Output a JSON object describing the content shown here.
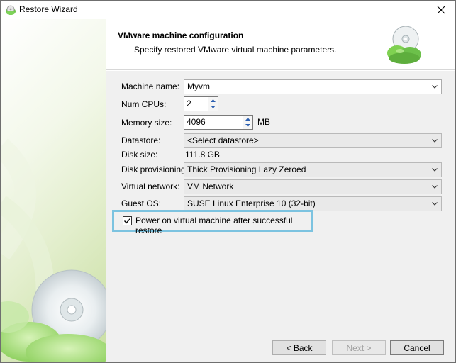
{
  "window": {
    "title": "Restore Wizard"
  },
  "header": {
    "title": "VMware machine configuration",
    "subtitle": "Specify restored VMware virtual machine parameters."
  },
  "form": {
    "machine_name": {
      "label": "Machine name:",
      "value": "Myvm"
    },
    "num_cpus": {
      "label": "Num CPUs:",
      "value": "2"
    },
    "memory_size": {
      "label": "Memory size:",
      "value": "4096",
      "unit": "MB"
    },
    "datastore": {
      "label": "Datastore:",
      "value": "<Select datastore>"
    },
    "disk_size": {
      "label": "Disk size:",
      "value": "111.8 GB"
    },
    "disk_provisioning": {
      "label": "Disk provisioning:",
      "value": "Thick Provisioning Lazy Zeroed"
    },
    "virtual_network": {
      "label": "Virtual network:",
      "value": "VM Network"
    },
    "guest_os": {
      "label": "Guest OS:",
      "value": "SUSE Linux Enterprise 10 (32-bit)"
    },
    "power_on": {
      "label": "Power on virtual machine after successful restore",
      "checked": true
    }
  },
  "buttons": {
    "back": "< Back",
    "next": "Next >",
    "cancel": "Cancel"
  },
  "icons": {
    "app": "restore-wizard-app-icon",
    "header": "cd-disc-cloud-icon",
    "close": "close-icon",
    "dropdown": "chevron-down-icon",
    "spin_up": "spin-up-icon",
    "spin_down": "spin-down-icon",
    "check": "checkmark-icon"
  },
  "colors": {
    "accent_green": "#6cc04a",
    "highlight_frame": "#7cc3e0",
    "spin_arrow": "#2b5fb0"
  }
}
